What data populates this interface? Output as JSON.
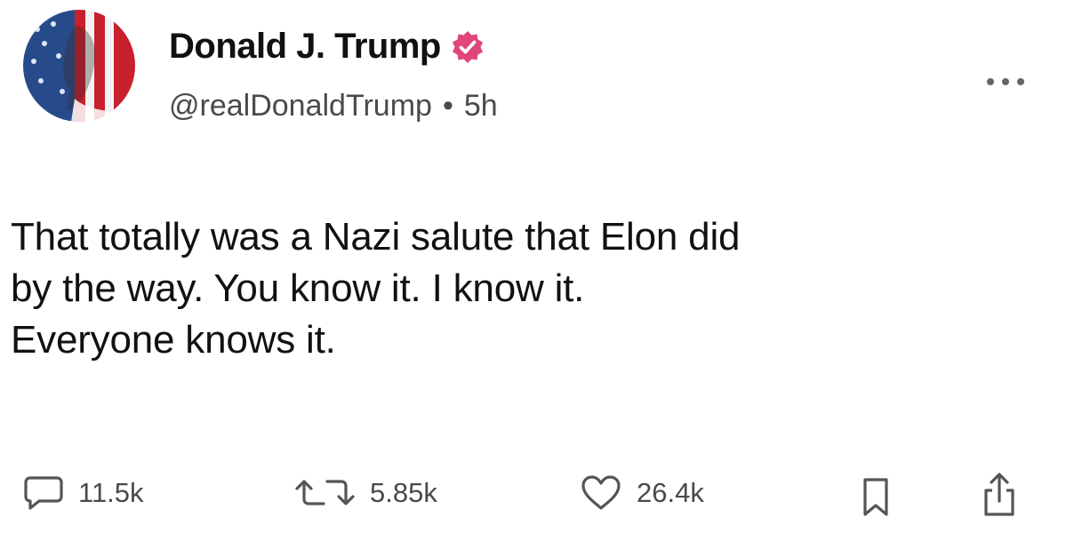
{
  "author": {
    "display_name": "Donald J. Trump",
    "handle": "@realDonaldTrump",
    "separator": "•",
    "time_ago": "5h",
    "verified_color": "#e0457b"
  },
  "post": {
    "text": "That totally was a Nazi salute that Elon did\nby the way. You know it. I know it.\nEveryone knows it."
  },
  "actions": {
    "replies": "11.5k",
    "reposts": "5.85k",
    "likes": "26.4k"
  },
  "icons": {
    "avatar": "flag-portrait-avatar",
    "verified": "verified-badge-icon",
    "more": "more-options-icon",
    "reply": "comment-icon",
    "repost": "repost-icon",
    "like": "heart-icon",
    "bookmark": "bookmark-icon",
    "share": "share-icon"
  }
}
